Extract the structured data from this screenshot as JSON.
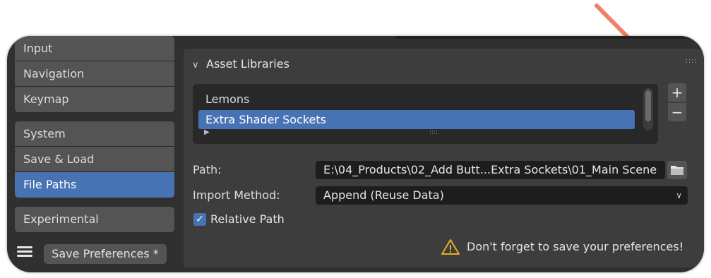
{
  "sidebar": {
    "groups": [
      [
        "Input",
        "Navigation",
        "Keymap"
      ],
      [
        "System",
        "Save & Load",
        "File Paths"
      ],
      [
        "Experimental"
      ]
    ],
    "active": "File Paths",
    "save_label": "Save Preferences *",
    "menu_icon": "hamburger-menu-icon"
  },
  "panel": {
    "title": "Asset Libraries",
    "expanded": true,
    "libraries": [
      "Lemons",
      "Extra Shader Sockets"
    ],
    "selected_library": "Extra Shader Sockets",
    "add_label": "+",
    "remove_label": "−",
    "path": {
      "label": "Path:",
      "value": "E:\\04_Products\\02_Add Butt...Extra Sockets\\01_Main Scene"
    },
    "import_method": {
      "label": "Import Method:",
      "value": "Append (Reuse Data)"
    },
    "relative_path": {
      "label": "Relative Path",
      "checked": true
    },
    "warning": "Don't forget to save your preferences!"
  },
  "colors": {
    "accent": "#4772b3",
    "arrow": "#f08068",
    "warning_icon": "#e8b020"
  }
}
